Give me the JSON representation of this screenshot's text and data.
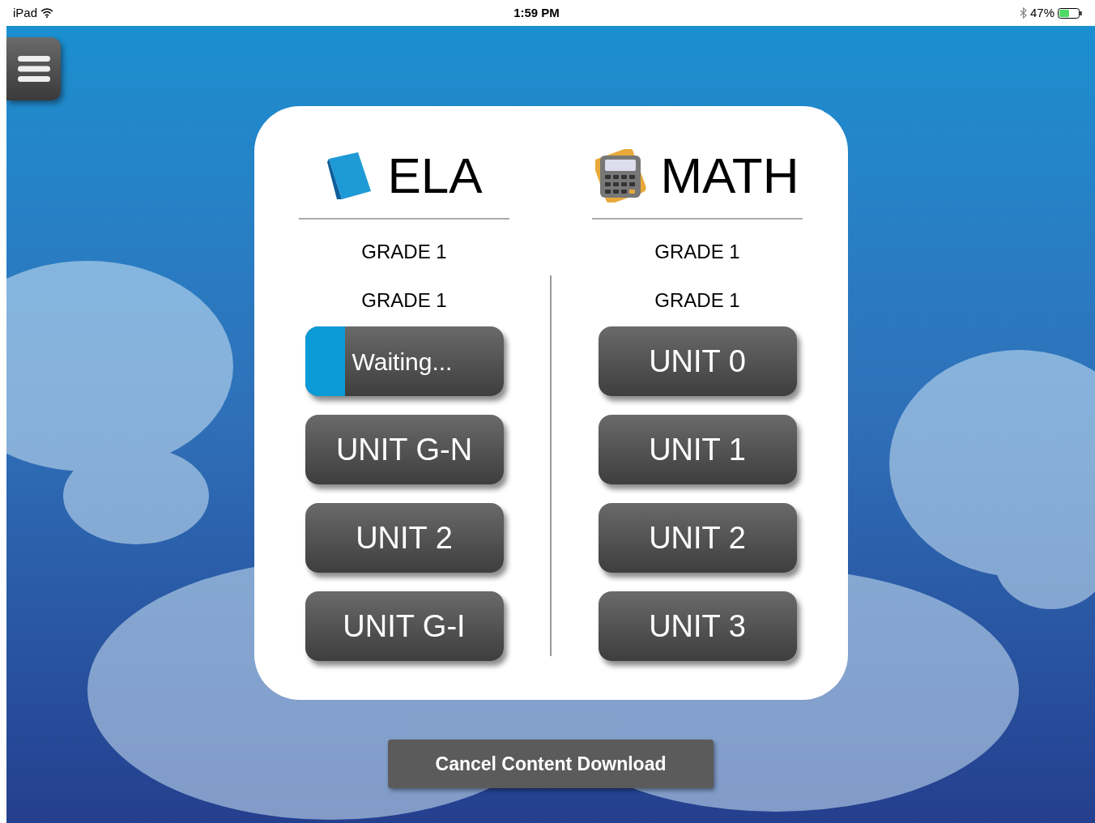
{
  "status_bar": {
    "device": "iPad",
    "time": "1:59 PM",
    "battery": "47%"
  },
  "subjects": [
    {
      "title": "ELA",
      "kind": "book",
      "grades": [
        "GRADE 1",
        "GRADE 1"
      ],
      "units": [
        {
          "kind": "progress",
          "label": "Waiting...",
          "level": 0.2
        },
        {
          "kind": "unit",
          "label": "UNIT G-N"
        },
        {
          "kind": "unit",
          "label": "UNIT 2"
        },
        {
          "kind": "unit",
          "label": "UNIT G-I"
        }
      ]
    },
    {
      "title": "MATH",
      "kind": "calculator",
      "grades": [
        "GRADE 1",
        "GRADE 1"
      ],
      "units": [
        {
          "kind": "unit",
          "label": "UNIT 0"
        },
        {
          "kind": "unit",
          "label": "UNIT 1"
        },
        {
          "kind": "unit",
          "label": "UNIT 2"
        },
        {
          "kind": "unit",
          "label": "UNIT 3"
        }
      ]
    }
  ],
  "cancel_button": "Cancel Content Download"
}
